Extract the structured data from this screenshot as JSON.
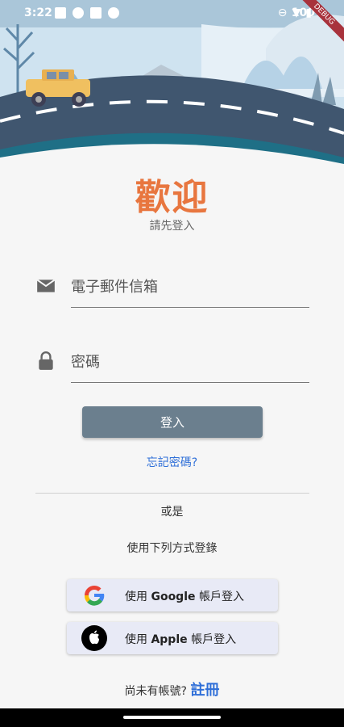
{
  "status_bar": {
    "time": "3:22",
    "battery": "100%",
    "debug_banner": "DEBUG"
  },
  "header": {
    "title": "歡迎",
    "subtitle": "請先登入"
  },
  "form": {
    "email": {
      "placeholder": "電子郵件信箱",
      "value": ""
    },
    "password": {
      "placeholder": "密碼",
      "value": ""
    },
    "login_label": "登入",
    "forgot_label": "忘記密碼?"
  },
  "alt": {
    "or_label": "或是",
    "method_label": "使用下列方式登錄",
    "google": {
      "prefix": "使用 ",
      "brand": "Google",
      "suffix": " 帳戶登入"
    },
    "apple": {
      "prefix": "使用 ",
      "brand": "Apple",
      "suffix": " 帳戶登入"
    }
  },
  "signup": {
    "prompt": "尚未有帳號?",
    "link_label": "註冊"
  },
  "colors": {
    "title": "#e8763f",
    "link": "#2f6fd8",
    "button": "#6b7f8e",
    "sso_bg": "#e8eaf6"
  }
}
